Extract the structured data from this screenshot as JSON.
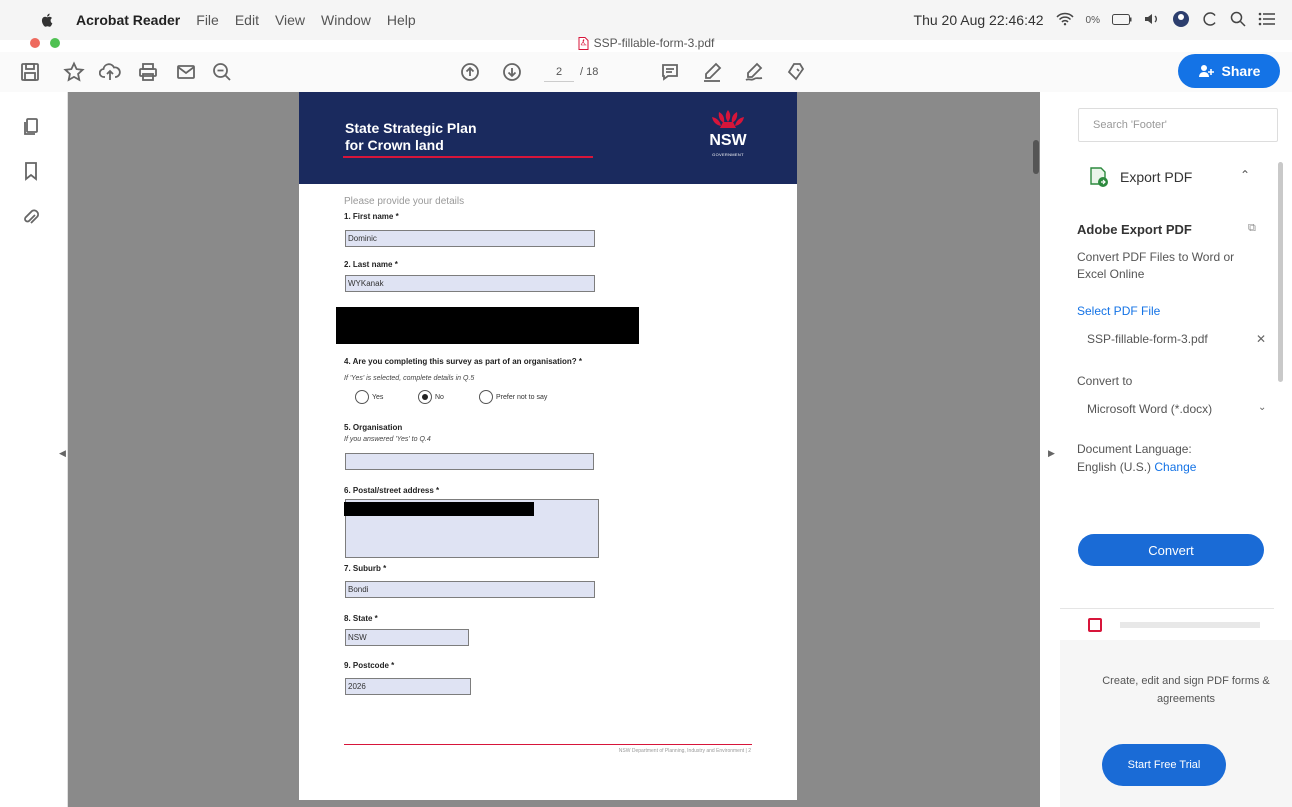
{
  "menubar": {
    "app_name": "Acrobat Reader",
    "menus": [
      "File",
      "Edit",
      "View",
      "Window",
      "Help"
    ],
    "clock": "Thu 20 Aug  22:46:42",
    "battery": "0%"
  },
  "window": {
    "title": "SSP-fillable-form-3.pdf"
  },
  "toolbar": {
    "page_current": "2",
    "page_total": "/ 18",
    "share_label": "Share"
  },
  "document": {
    "header_title_line1": "State Strategic Plan",
    "header_title_line2": "for Crown land",
    "logo_text": "NSW",
    "logo_sub": "GOVERNMENT",
    "intro": "Please provide your details",
    "q1_label": "1. First name *",
    "q1_value": "Dominic",
    "q2_label": "2. Last name *",
    "q2_value": "WYKanak",
    "q4_label": "4. Are you completing this survey as part of an organisation? *",
    "q4_hint": "If 'Yes' is selected, complete details in Q.5",
    "q4_options": [
      "Yes",
      "No",
      "Prefer not to say"
    ],
    "q4_selected": "No",
    "q5_label": "5. Organisation",
    "q5_hint": "If you answered 'Yes' to Q.4",
    "q5_value": "",
    "q6_label": "6. Postal/street address *",
    "q7_label": "7. Suburb *",
    "q7_value": "Bondi",
    "q8_label": "8. State *",
    "q8_value": "NSW",
    "q9_label": "9. Postcode *",
    "q9_value": "2026",
    "footer_text": "NSW Department of Planning, Industry and Environment | 2"
  },
  "right_panel": {
    "search_placeholder": "Search 'Footer'",
    "export_tool": "Export PDF",
    "section_title": "Adobe Export PDF",
    "description": "Convert PDF Files to Word or Excel Online",
    "select_link": "Select PDF File",
    "file_name": "SSP-fillable-form-3.pdf",
    "convert_to_label": "Convert to",
    "convert_to_value": "Microsoft Word (*.docx)",
    "doc_lang_label": "Document Language:",
    "doc_lang_value": "English (U.S.)",
    "change_link": "Change",
    "convert_button": "Convert",
    "promo_text": "Create, edit and sign PDF forms & agreements",
    "trial_button": "Start Free Trial"
  },
  "colors": {
    "accent": "#1473e6",
    "nsw_navy": "#1a2a5e",
    "nsw_red": "#d7153a",
    "canvas_gray": "#8a8a8a"
  },
  "icons": [
    "apple-icon",
    "wifi-icon",
    "volume-icon",
    "search-icon",
    "list-icon",
    "save-icon",
    "star-icon",
    "upload-icon",
    "print-icon",
    "mail-icon",
    "zoom-out-icon",
    "page-up-icon",
    "page-down-icon",
    "comment-icon",
    "highlight-icon",
    "sign-icon",
    "stamp-icon",
    "pages-icon",
    "bookmark-icon",
    "attachment-icon",
    "export-pdf-icon",
    "pdf-file-icon"
  ]
}
